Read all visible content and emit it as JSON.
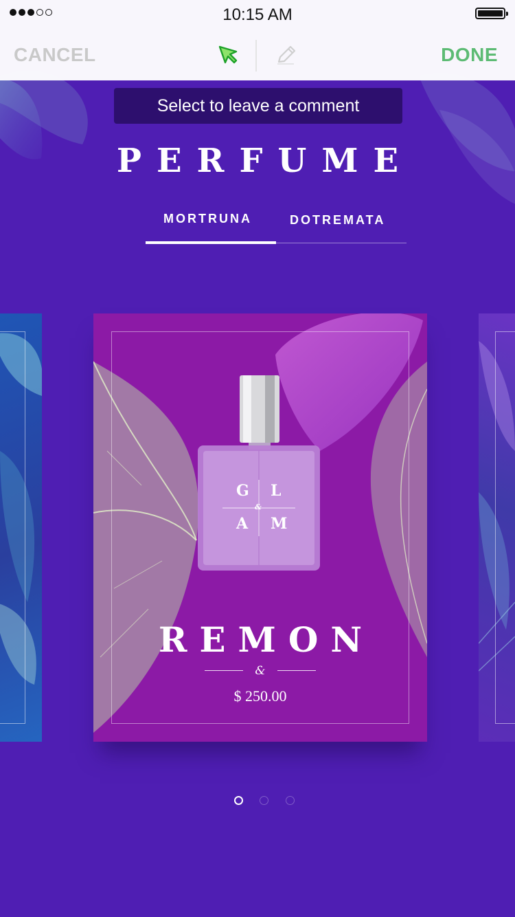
{
  "status_bar": {
    "time": "10:15 AM",
    "signal_bars_filled": 3,
    "signal_bars_total": 5,
    "battery_level": 1.0
  },
  "toolbar": {
    "cancel_label": "CANCEL",
    "done_label": "DONE",
    "tools": [
      "select-arrow-icon",
      "pencil-icon"
    ],
    "active_tool": "select-arrow-icon",
    "accent_color": "#5dbb74"
  },
  "tooltip": {
    "text": "Select to leave a comment"
  },
  "header": {
    "title": "PERFUME",
    "tabs": [
      {
        "label": "MORTRUNA",
        "active": true
      },
      {
        "label": "DOTREMATA",
        "active": false
      }
    ]
  },
  "product": {
    "bottle_label_letters": [
      "G",
      "L",
      "A",
      "M"
    ],
    "bottle_label_amp": "&",
    "name": "REMON",
    "ornament": "&",
    "price": "$ 250.00"
  },
  "carousel": {
    "page_count": 3,
    "current_page": 1
  },
  "colors": {
    "background": "#4f1eb3",
    "card": "#8c1aa6",
    "tooltip": "#2d0f6e"
  }
}
